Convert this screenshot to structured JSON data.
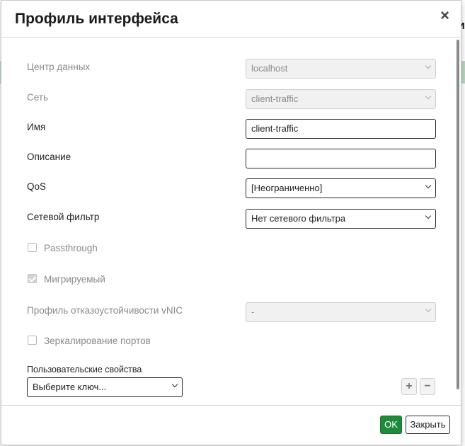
{
  "dialog": {
    "title": "Профиль интерфейса",
    "close_glyph": "×"
  },
  "background": {
    "partial_glyph": "и"
  },
  "form": {
    "datacenter": {
      "label": "Центр данных",
      "value": "localhost",
      "disabled": true
    },
    "network": {
      "label": "Сеть",
      "value": "client-traffic",
      "disabled": true
    },
    "name": {
      "label": "Имя",
      "value": "client-traffic"
    },
    "description": {
      "label": "Описание",
      "value": ""
    },
    "qos": {
      "label": "QoS",
      "value": "[Неограниченно]"
    },
    "network_filter": {
      "label": "Сетевой фильтр",
      "value": "Нет сетевого фильтра"
    },
    "passthrough": {
      "label": "Passthrough",
      "checked": false,
      "disabled": true
    },
    "migratable": {
      "label": "Мигрируемый",
      "checked": true,
      "disabled": true
    },
    "failover_profile": {
      "label": "Профиль отказоустойчивости vNIC",
      "value": "-",
      "disabled": true
    },
    "port_mirroring": {
      "label": "Зеркалирование портов",
      "checked": false,
      "disabled": true
    }
  },
  "custom_properties": {
    "title": "Пользовательские свойства",
    "key_placeholder": "Выберите ключ...",
    "add_glyph": "+",
    "remove_glyph": "−"
  },
  "footer": {
    "ok_label": "OK",
    "close_label": "Закрыть"
  },
  "colors": {
    "ok_button": "#1f8a3b",
    "disabled_text": "#8a8a8a"
  }
}
